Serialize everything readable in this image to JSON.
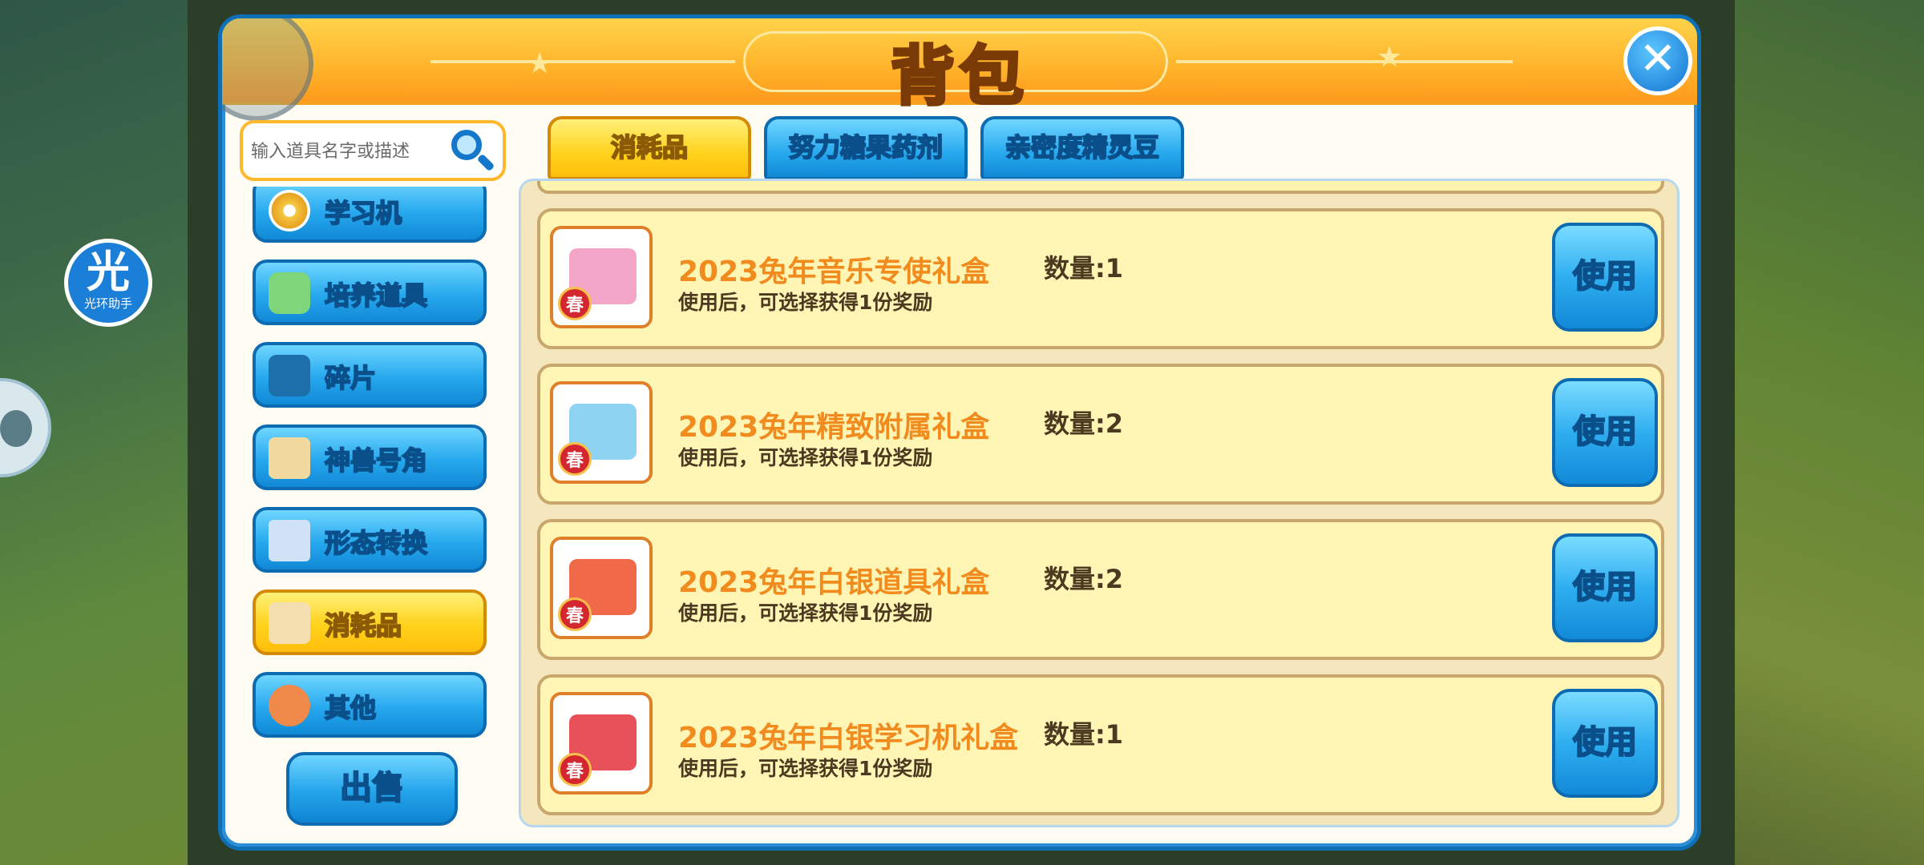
{
  "window": {
    "title": "背包",
    "close_icon": "close-icon"
  },
  "overlay": {
    "assistant_glyph": "光",
    "assistant_label": "光环助手"
  },
  "search": {
    "placeholder": "输入道具名字或描述",
    "icon": "search-icon"
  },
  "categories": [
    {
      "label": "学习机",
      "icon": "disc-icon",
      "active": false
    },
    {
      "label": "培养道具",
      "icon": "potion-icon",
      "active": false
    },
    {
      "label": "碎片",
      "icon": "puzzle-icon",
      "active": false
    },
    {
      "label": "神兽号角",
      "icon": "horn-icon",
      "active": false
    },
    {
      "label": "形态转换",
      "icon": "plane-icon",
      "active": false
    },
    {
      "label": "消耗品",
      "icon": "box-icon",
      "active": true
    },
    {
      "label": "其他",
      "icon": "megaphone-icon",
      "active": false
    }
  ],
  "sell_button": {
    "label": "出售"
  },
  "tabs": [
    {
      "label": "消耗品",
      "active": true
    },
    {
      "label": "努力糖果药剂",
      "active": false
    },
    {
      "label": "亲密度精灵豆",
      "active": false
    }
  ],
  "items": [
    {
      "name": "2023兔年音乐专使礼盒",
      "quantity": "数量:1",
      "description": "使用后，可选择获得1份奖励",
      "badge": "春",
      "use_label": "使用",
      "color": "#f3a6c8"
    },
    {
      "name": "2023兔年精致附属礼盒",
      "quantity": "数量:2",
      "description": "使用后，可选择获得1份奖励",
      "badge": "春",
      "use_label": "使用",
      "color": "#8fd3f2"
    },
    {
      "name": "2023兔年白银道具礼盒",
      "quantity": "数量:2",
      "description": "使用后，可选择获得1份奖励",
      "badge": "春",
      "use_label": "使用",
      "color": "#f06a4a"
    },
    {
      "name": "2023兔年白银学习机礼盒",
      "quantity": "数量:1",
      "description": "使用后，可选择获得1份奖励",
      "badge": "春",
      "use_label": "使用",
      "color": "#e8505a"
    }
  ]
}
